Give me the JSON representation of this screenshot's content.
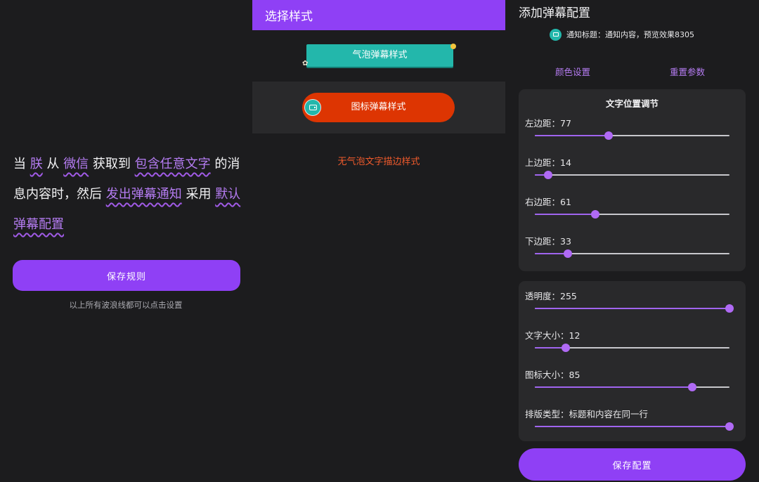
{
  "rule_panel": {
    "sentence": [
      {
        "text": "当 ",
        "link": false
      },
      {
        "text": "朕",
        "link": true
      },
      {
        "text": " 从 ",
        "link": false
      },
      {
        "text": "微信",
        "link": true
      },
      {
        "text": " 获取到 ",
        "link": false
      },
      {
        "text": "包含任意文字",
        "link": true
      },
      {
        "text": " 的消息内容时，然后 ",
        "link": false
      },
      {
        "text": "发出弹幕通知",
        "link": true
      },
      {
        "text": " 采用 ",
        "link": false
      },
      {
        "text": "默认弹幕配置",
        "link": true
      }
    ],
    "save_label": "保存规则",
    "hint": "以上所有波浪线都可以点击设置"
  },
  "style_panel": {
    "title": "选择样式",
    "bubble_label": "气泡弹幕样式",
    "icon_label": "图标弹幕样式",
    "no_bubble_label": "无气泡文字描边样式"
  },
  "config_panel": {
    "title": "添加弹幕配置",
    "preview_text": "通知标题：通知内容，预览效果8305",
    "color_label": "颜色设置",
    "reset_label": "重置参数",
    "position_title": "文字位置调节",
    "position_sliders": [
      {
        "label": "左边距：77",
        "fraction": 0.38
      },
      {
        "label": "上边距：14",
        "fraction": 0.07
      },
      {
        "label": "右边距：61",
        "fraction": 0.31
      },
      {
        "label": "下边距：33",
        "fraction": 0.17
      }
    ],
    "other_sliders": [
      {
        "label": "透明度：255",
        "fraction": 1.0
      },
      {
        "label": "文字大小：12",
        "fraction": 0.16
      },
      {
        "label": "图标大小：85",
        "fraction": 0.81
      },
      {
        "label": "排版类型：标题和内容在同一行",
        "fraction": 1.0
      }
    ],
    "save_label": "保存配置"
  }
}
